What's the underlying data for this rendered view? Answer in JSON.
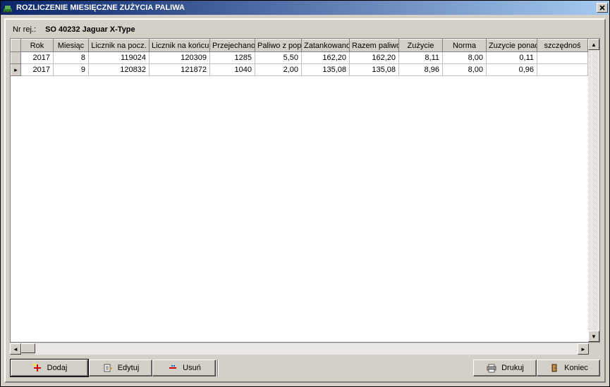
{
  "window": {
    "title": "ROZLICZENIE MIESIĘCZNE ZUŻYCIA PALIWA"
  },
  "header": {
    "nr_rej_label": "Nr rej.:",
    "nr_rej_value": "SO 40232  Jaguar X-Type"
  },
  "grid": {
    "columns": [
      "",
      "Rok",
      "Miesiąc",
      "Licznik na pocz.",
      "Licznik na końcu",
      "Przejechano",
      "Paliwo z pop.",
      "Zatankowano",
      "Razem paliwo",
      "Zużycie",
      "Norma",
      "Zuzycie ponad",
      "szczędnoś"
    ],
    "rows": [
      {
        "indicator": "",
        "rok": "2017",
        "miesiac": "8",
        "licznik_pocz": "119024",
        "licznik_konc": "120309",
        "przejechano": "1285",
        "paliwo_pop": "5,50",
        "zatankowano": "162,20",
        "razem_paliwo": "162,20",
        "zuzycie": "8,11",
        "norma": "8,00",
        "zuzycie_ponad": "0,11",
        "oszczednosc": ""
      },
      {
        "indicator": "▸",
        "rok": "2017",
        "miesiac": "9",
        "licznik_pocz": "120832",
        "licznik_konc": "121872",
        "przejechano": "1040",
        "paliwo_pop": "2,00",
        "zatankowano": "135,08",
        "razem_paliwo": "135,08",
        "zuzycie": "8,96",
        "norma": "8,00",
        "zuzycie_ponad": "0,96",
        "oszczednosc": ""
      }
    ]
  },
  "buttons": {
    "dodaj": "Dodaj",
    "edytuj": "Edytuj",
    "usun": "Usuń",
    "drukuj": "Drukuj",
    "koniec": "Koniec"
  },
  "scroll": {
    "up": "▲",
    "down": "▼",
    "left": "◄",
    "right": "►"
  }
}
